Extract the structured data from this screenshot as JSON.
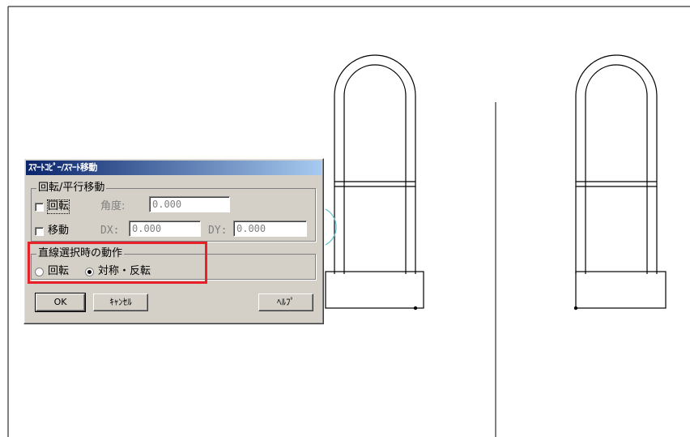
{
  "dialog": {
    "title": "ｽﾏｰﾄｺﾋﾟｰ/ｽﾏｰﾄ移動",
    "group_transform": {
      "label": "回転/平行移動",
      "rotate_label": "回転",
      "angle_label": "角度:",
      "angle_value": "0.000",
      "move_label": "移動",
      "dx_label": "DX:",
      "dx_value": "0.000",
      "dy_label": "DY:",
      "dy_value": "0.000"
    },
    "group_line": {
      "label": "直線選択時の動作",
      "option_rotate": "回転",
      "option_mirror": "対称・反転",
      "selected": "対称・反転"
    },
    "buttons": {
      "ok": "OK",
      "cancel": "ｷｬﾝｾﾙ",
      "help": "ﾍﾙﾌﾟ"
    }
  },
  "colors": {
    "highlight": "#e8202a",
    "titlebar": "#0a246a"
  }
}
